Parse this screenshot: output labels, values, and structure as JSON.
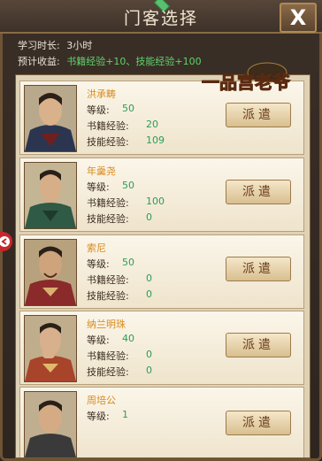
{
  "dialog": {
    "title": "门客选择",
    "close_label": "X",
    "study_time_label": "学习时长:",
    "study_time_value": "3小时",
    "expected_label": "预计收益:",
    "expected_gains": "书籍经验+10、技能经验+100"
  },
  "logo": {
    "text": "一品宫老爷"
  },
  "labels": {
    "level": "等级:",
    "book_exp": "书籍经验:",
    "skill_exp": "技能经验:",
    "dispatch": "派遣"
  },
  "retainers": [
    {
      "name": "洪承畴",
      "level": "50",
      "book_exp": "20",
      "skill_exp": "109"
    },
    {
      "name": "年羹尧",
      "level": "50",
      "book_exp": "100",
      "skill_exp": "0"
    },
    {
      "name": "索尼",
      "level": "50",
      "book_exp": "0",
      "skill_exp": "0"
    },
    {
      "name": "纳兰明珠",
      "level": "40",
      "book_exp": "0",
      "skill_exp": "0"
    },
    {
      "name": "周培公",
      "level": "1",
      "book_exp": "",
      "skill_exp": ""
    }
  ]
}
